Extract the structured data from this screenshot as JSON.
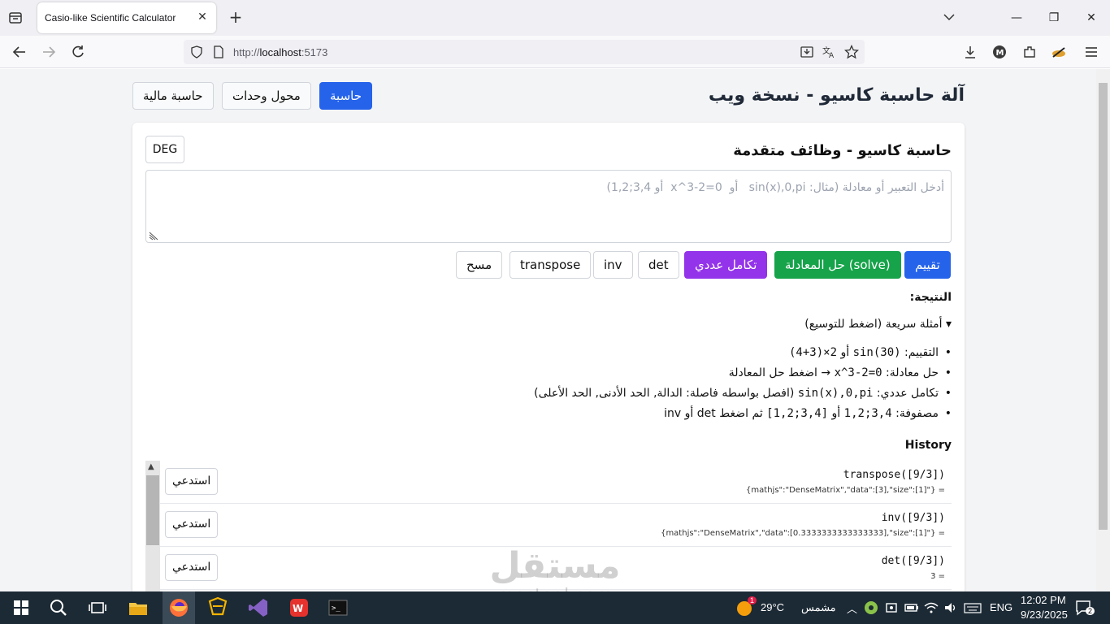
{
  "browser": {
    "tab_title": "Casio-like Scientific Calculator",
    "url_prefix": "http://",
    "url_host": "localhost",
    "url_suffix": ":5173"
  },
  "app": {
    "title": "آلة حاسبة كاسيو - نسخة ويب",
    "nav": {
      "calculator": "حاسبة",
      "converter": "محول وحدات",
      "financial": "حاسبة مالية"
    }
  },
  "calculator": {
    "title": "حاسبة كاسيو - وظائف متقدمة",
    "mode": "DEG",
    "placeholder": "أدخل التعبير أو معادلة (مثال: sin(x),0,pi   أو  0=x^3-2  أو 3,4;1,2)",
    "buttons": {
      "evaluate": "تقييم",
      "solve": "حل المعادلة (solve)",
      "integrate": "تكامل عددي",
      "det": "det",
      "inv": "inv",
      "transpose": "transpose",
      "clear": "مسح"
    },
    "result_label": "النتيجة:",
    "examples_summary": "▾ أمثلة سريعة (اضغط للتوسيع)",
    "examples": [
      {
        "prefix": "التقييم: ",
        "code": "sin(30)",
        "mid": " أو ",
        "code2": "2×(3+4)",
        "suffix": ""
      },
      {
        "prefix": "حل معادلة: ",
        "code": "x^3-2=0",
        "mid": " → اضغط حل المعادلة",
        "code2": "",
        "suffix": ""
      },
      {
        "prefix": "تكامل عددي: ",
        "code": "sin(x),0,pi",
        "mid": " (افصل بواسطه فاصلة: الدالة, الحد الأدنى, الحد الأعلى)",
        "code2": "",
        "suffix": ""
      },
      {
        "prefix": "مصفوفة: ",
        "code": "3,4;1,2",
        "mid": " أو ",
        "code2": "[3,4;1,2]",
        "suffix": " ثم اضغط det أو inv"
      }
    ],
    "history_label": "History",
    "history": [
      {
        "expr": "transpose([9/3])",
        "result": "{mathjs\":\"DenseMatrix\",\"data\":[3],\"size\":[1]\"} =",
        "recall": "استدعي"
      },
      {
        "expr": "inv([9/3])",
        "result": "{mathjs\":\"DenseMatrix\",\"data\":[0.3333333333333333],\"size\":[1]\"} =",
        "recall": "استدعي"
      },
      {
        "expr": "det([9/3])",
        "result": "3 =",
        "recall": "استدعي"
      }
    ]
  },
  "watermark": {
    "arabic": "مستقل",
    "latin": "mostaql.com"
  },
  "taskbar": {
    "weather_temp": "29°C",
    "weather_desc": "مشمس",
    "language": "ENG",
    "time": "12:02 PM",
    "date": "9/23/2025",
    "notifications": "2",
    "weather_badge": "1"
  }
}
